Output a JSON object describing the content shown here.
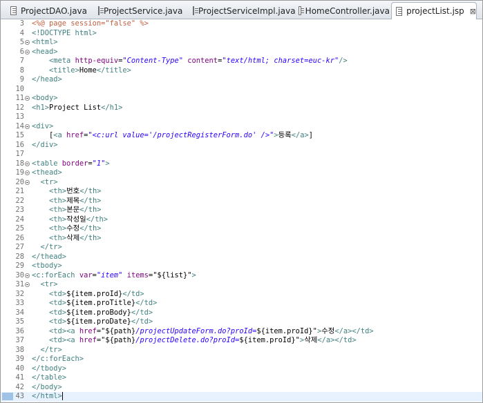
{
  "tabs": [
    {
      "label": "ProjectDAO.java",
      "active": false
    },
    {
      "label": "ProjectService.java",
      "active": false
    },
    {
      "label": "ProjectServiceImpl.java",
      "active": false
    },
    {
      "label": "HomeController.java",
      "active": false
    },
    {
      "label": "projectList.jsp",
      "active": true
    }
  ],
  "close_glyph": "⊠",
  "colors": {
    "tag": "#3f7f7f",
    "attr": "#7f007f",
    "string": "#2a00ff",
    "directive": "#bf5f3f",
    "current_line": "#e8f2fe"
  },
  "lines": [
    {
      "n": "3",
      "fold": false,
      "segs": [
        [
          "dir",
          "<%@ page session=\"false\" %>"
        ]
      ]
    },
    {
      "n": "4",
      "fold": false,
      "segs": [
        [
          "tag",
          "<!DOCTYPE html>"
        ]
      ]
    },
    {
      "n": "5",
      "fold": true,
      "segs": [
        [
          "tag",
          "<html>"
        ]
      ]
    },
    {
      "n": "6",
      "fold": true,
      "segs": [
        [
          "tag",
          "<head>"
        ]
      ]
    },
    {
      "n": "7",
      "fold": false,
      "segs": [
        [
          "plain",
          "    "
        ],
        [
          "tag",
          "<meta "
        ],
        [
          "attr",
          "http-equiv"
        ],
        [
          "plain",
          "="
        ],
        [
          "str",
          "\"Content-Type\""
        ],
        [
          "plain",
          " "
        ],
        [
          "attr",
          "content"
        ],
        [
          "plain",
          "="
        ],
        [
          "str",
          "\"text/html; charset=euc-kr\""
        ],
        [
          "tag",
          "/>"
        ]
      ]
    },
    {
      "n": "8",
      "fold": false,
      "segs": [
        [
          "plain",
          "    "
        ],
        [
          "tag",
          "<title>"
        ],
        [
          "plain",
          "Home"
        ],
        [
          "tag",
          "</title>"
        ]
      ]
    },
    {
      "n": "9",
      "fold": false,
      "segs": [
        [
          "tag",
          "</head>"
        ]
      ]
    },
    {
      "n": "10",
      "fold": false,
      "segs": []
    },
    {
      "n": "11",
      "fold": true,
      "segs": [
        [
          "tag",
          "<body>"
        ]
      ]
    },
    {
      "n": "12",
      "fold": false,
      "segs": [
        [
          "tag",
          "<h1>"
        ],
        [
          "plain",
          "Project List"
        ],
        [
          "tag",
          "</h1>"
        ]
      ]
    },
    {
      "n": "13",
      "fold": false,
      "segs": []
    },
    {
      "n": "14",
      "fold": true,
      "segs": [
        [
          "tag",
          "<div>"
        ]
      ]
    },
    {
      "n": "15",
      "fold": false,
      "segs": [
        [
          "plain",
          "    ["
        ],
        [
          "tag",
          "<a "
        ],
        [
          "attr",
          "href"
        ],
        [
          "plain",
          "="
        ],
        [
          "str",
          "\"<c:url value='/projectRegisterForm.do' />\""
        ],
        [
          "tag",
          ">"
        ],
        [
          "plain",
          "등록"
        ],
        [
          "tag",
          "</a>"
        ],
        [
          "plain",
          "]"
        ]
      ]
    },
    {
      "n": "16",
      "fold": false,
      "segs": [
        [
          "tag",
          "</div>"
        ]
      ]
    },
    {
      "n": "17",
      "fold": false,
      "segs": []
    },
    {
      "n": "18",
      "fold": true,
      "segs": [
        [
          "tag",
          "<table "
        ],
        [
          "attr",
          "border"
        ],
        [
          "plain",
          "="
        ],
        [
          "str",
          "\"1\""
        ],
        [
          "tag",
          ">"
        ]
      ]
    },
    {
      "n": "19",
      "fold": true,
      "segs": [
        [
          "tag",
          "<thead>"
        ]
      ]
    },
    {
      "n": "20",
      "fold": true,
      "segs": [
        [
          "plain",
          "  "
        ],
        [
          "tag",
          "<tr>"
        ]
      ]
    },
    {
      "n": "21",
      "fold": false,
      "segs": [
        [
          "plain",
          "    "
        ],
        [
          "tag",
          "<th>"
        ],
        [
          "plain",
          "번호"
        ],
        [
          "tag",
          "</th>"
        ]
      ]
    },
    {
      "n": "22",
      "fold": false,
      "segs": [
        [
          "plain",
          "    "
        ],
        [
          "tag",
          "<th>"
        ],
        [
          "plain",
          "제목"
        ],
        [
          "tag",
          "</th>"
        ]
      ]
    },
    {
      "n": "23",
      "fold": false,
      "segs": [
        [
          "plain",
          "    "
        ],
        [
          "tag",
          "<th>"
        ],
        [
          "plain",
          "본문"
        ],
        [
          "tag",
          "</th>"
        ]
      ]
    },
    {
      "n": "24",
      "fold": false,
      "segs": [
        [
          "plain",
          "    "
        ],
        [
          "tag",
          "<th>"
        ],
        [
          "plain",
          "작성일"
        ],
        [
          "tag",
          "</th>"
        ]
      ]
    },
    {
      "n": "25",
      "fold": false,
      "segs": [
        [
          "plain",
          "    "
        ],
        [
          "tag",
          "<th>"
        ],
        [
          "plain",
          "수정"
        ],
        [
          "tag",
          "</th>"
        ]
      ]
    },
    {
      "n": "26",
      "fold": false,
      "segs": [
        [
          "plain",
          "    "
        ],
        [
          "tag",
          "<th>"
        ],
        [
          "plain",
          "삭제"
        ],
        [
          "tag",
          "</th>"
        ]
      ]
    },
    {
      "n": "27",
      "fold": false,
      "segs": [
        [
          "plain",
          "  "
        ],
        [
          "tag",
          "</tr>"
        ]
      ]
    },
    {
      "n": "28",
      "fold": false,
      "segs": [
        [
          "tag",
          "</thead>"
        ]
      ]
    },
    {
      "n": "29",
      "fold": false,
      "segs": [
        [
          "tag",
          "<tbody>"
        ]
      ]
    },
    {
      "n": "30",
      "fold": true,
      "segs": [
        [
          "tag",
          "<c:forEach "
        ],
        [
          "attr",
          "var"
        ],
        [
          "plain",
          "="
        ],
        [
          "str",
          "\"item\""
        ],
        [
          "plain",
          " "
        ],
        [
          "attr",
          "items"
        ],
        [
          "plain",
          "=\"${list}\""
        ],
        [
          "tag",
          ">"
        ]
      ]
    },
    {
      "n": "31",
      "fold": true,
      "segs": [
        [
          "plain",
          "  "
        ],
        [
          "tag",
          "<tr>"
        ]
      ]
    },
    {
      "n": "32",
      "fold": false,
      "segs": [
        [
          "plain",
          "    "
        ],
        [
          "tag",
          "<td>"
        ],
        [
          "plain",
          "${item.proId}"
        ],
        [
          "tag",
          "</td>"
        ]
      ]
    },
    {
      "n": "33",
      "fold": false,
      "segs": [
        [
          "plain",
          "    "
        ],
        [
          "tag",
          "<td>"
        ],
        [
          "plain",
          "${item.proTitle}"
        ],
        [
          "tag",
          "</td>"
        ]
      ]
    },
    {
      "n": "34",
      "fold": false,
      "segs": [
        [
          "plain",
          "    "
        ],
        [
          "tag",
          "<td>"
        ],
        [
          "plain",
          "${item.proBody}"
        ],
        [
          "tag",
          "</td>"
        ]
      ]
    },
    {
      "n": "35",
      "fold": false,
      "segs": [
        [
          "plain",
          "    "
        ],
        [
          "tag",
          "<td>"
        ],
        [
          "plain",
          "${item.proDate}"
        ],
        [
          "tag",
          "</td>"
        ]
      ]
    },
    {
      "n": "36",
      "fold": false,
      "segs": [
        [
          "plain",
          "    "
        ],
        [
          "tag",
          "<td>"
        ],
        [
          "tag",
          "<a "
        ],
        [
          "attr",
          "href"
        ],
        [
          "plain",
          "=\"${path}"
        ],
        [
          "str",
          "/projectUpdateForm.do?proId="
        ],
        [
          "plain",
          "${item.proId}\""
        ],
        [
          "tag",
          ">"
        ],
        [
          "plain",
          "수정"
        ],
        [
          "tag",
          "</a></td>"
        ]
      ]
    },
    {
      "n": "37",
      "fold": false,
      "segs": [
        [
          "plain",
          "    "
        ],
        [
          "tag",
          "<td>"
        ],
        [
          "tag",
          "<a "
        ],
        [
          "attr",
          "href"
        ],
        [
          "plain",
          "=\"${path}"
        ],
        [
          "str",
          "/projectDelete.do?proId="
        ],
        [
          "plain",
          "${item.proId}\""
        ],
        [
          "tag",
          ">"
        ],
        [
          "plain",
          "삭제"
        ],
        [
          "tag",
          "</a></td>"
        ]
      ]
    },
    {
      "n": "38",
      "fold": false,
      "segs": [
        [
          "plain",
          "  "
        ],
        [
          "tag",
          "</tr>"
        ]
      ]
    },
    {
      "n": "39",
      "fold": false,
      "segs": [
        [
          "tag",
          "</c:forEach>"
        ]
      ]
    },
    {
      "n": "40",
      "fold": false,
      "segs": [
        [
          "tag",
          "</tbody>"
        ]
      ]
    },
    {
      "n": "41",
      "fold": false,
      "segs": [
        [
          "tag",
          "</table>"
        ]
      ]
    },
    {
      "n": "42",
      "fold": false,
      "segs": [
        [
          "tag",
          "</body>"
        ]
      ]
    },
    {
      "n": "43",
      "fold": false,
      "current": true,
      "segs": [
        [
          "tag",
          "</html>"
        ]
      ]
    }
  ]
}
